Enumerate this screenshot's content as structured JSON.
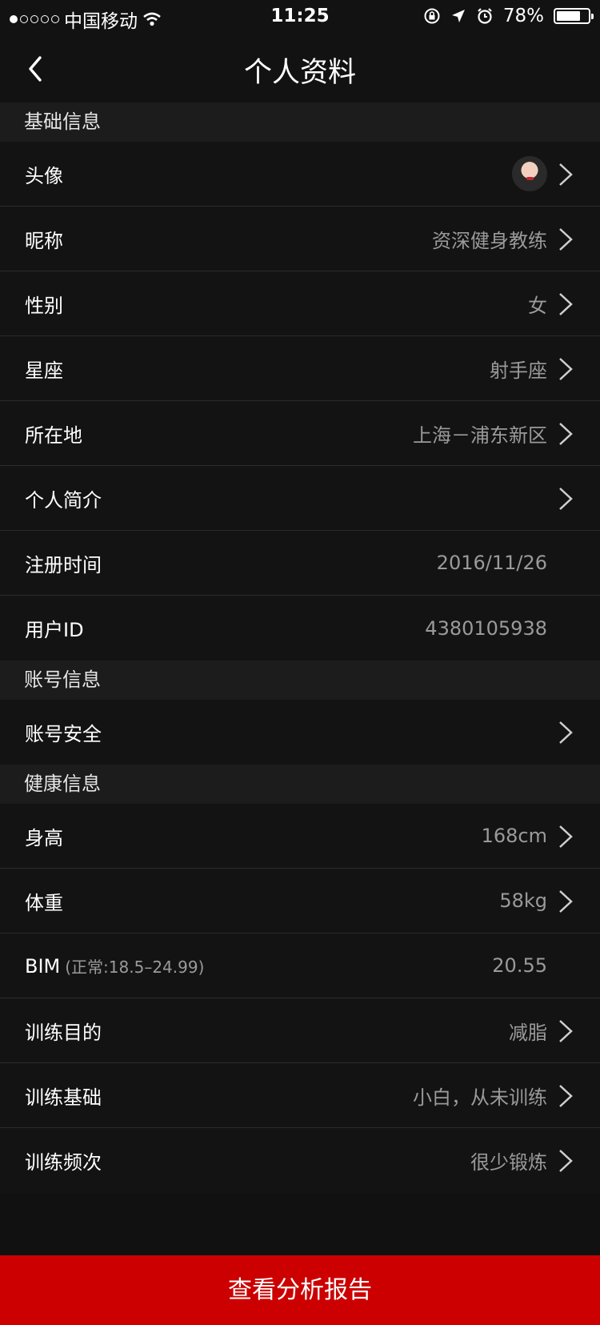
{
  "status_bar": {
    "carrier": "中国移动",
    "time": "11:25",
    "battery": "78%",
    "battery_level": 0.78
  },
  "nav": {
    "title": "个人资料"
  },
  "sections": {
    "basic": {
      "title": "基础信息",
      "rows": [
        {
          "label": "头像",
          "value": ""
        },
        {
          "label": "昵称",
          "value": "资深健身教练"
        },
        {
          "label": "性别",
          "value": "女"
        },
        {
          "label": "星座",
          "value": "射手座"
        },
        {
          "label": "所在地",
          "value": "上海－浦东新区"
        },
        {
          "label": "个人简介",
          "value": ""
        },
        {
          "label": "注册时间",
          "value": "2016/11/26"
        },
        {
          "label": "用户ID",
          "value": "4380105938"
        }
      ]
    },
    "account": {
      "title": "账号信息",
      "rows": [
        {
          "label": "账号安全",
          "value": ""
        }
      ]
    },
    "health": {
      "title": "健康信息",
      "rows": [
        {
          "label": "身高",
          "value": "168cm"
        },
        {
          "label": "体重",
          "value": "58kg"
        },
        {
          "label": "BIM",
          "hint": "(正常:18.5–24.99)",
          "value": "20.55"
        },
        {
          "label": "训练目的",
          "value": "减脂"
        },
        {
          "label": "训练基础",
          "value": "小白，从未训练"
        },
        {
          "label": "训练频次",
          "value": "很少锻炼"
        }
      ]
    }
  },
  "bottom_button": {
    "label": "查看分析报告"
  }
}
